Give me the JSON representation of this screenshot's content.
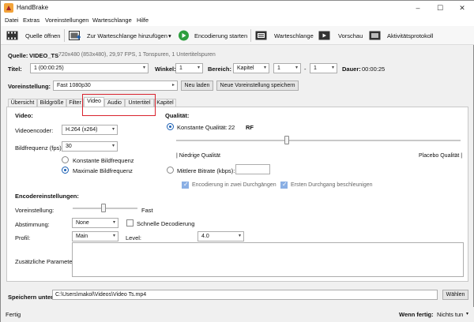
{
  "window": {
    "title": "HandBrake",
    "minimize": "–",
    "maximize": "☐",
    "close": "✕"
  },
  "menu": [
    "Datei",
    "Extras",
    "Voreinstellungen",
    "Warteschlange",
    "Hilfe"
  ],
  "toolbar": {
    "open_source": "Quelle öffnen",
    "add_queue": "Zur Warteschlange hinzufügen",
    "add_queue_arrow": "▾",
    "start": "Encodierung starten",
    "queue": "Warteschlange",
    "preview": "Vorschau",
    "activity": "Aktivitätsprotokoll"
  },
  "source": {
    "label": "Quelle:",
    "name": "VIDEO_TS",
    "info": "720x480 (853x480), 29,97 FPS, 1 Tonspuren, 1 Untertitelspuren"
  },
  "title_row": {
    "title_label": "Titel:",
    "title_value": "1 (00:00:25)",
    "angle_label": "Winkel:",
    "angle_value": "1",
    "range_label": "Bereich:",
    "range_type": "Kapitel",
    "range_from": "1",
    "range_sep": "-",
    "range_to": "1",
    "duration_label": "Dauer:",
    "duration_value": "00:00:25"
  },
  "preset": {
    "label": "Voreinstellung:",
    "value": "Fast 1080p30",
    "reload": "Neu laden",
    "save_new": "Neue Voreinstellung speichern"
  },
  "tabs": [
    "Übersicht",
    "Bildgröße",
    "Filter",
    "Video",
    "Audio",
    "Untertitel",
    "Kapitel"
  ],
  "active_tab": "Video",
  "video": {
    "section": "Video:",
    "encoder_label": "Videoencoder:",
    "encoder_value": "H.264 (x264)",
    "fps_label": "Bildfrequenz (fps):",
    "fps_value": "30",
    "constant_fps": "Konstante Bildfrequenz",
    "peak_fps": "Maximale Bildfrequenz",
    "peak_fps_selected": true
  },
  "quality": {
    "section": "Qualität:",
    "cq_label": "Konstante Qualität:",
    "cq_value": "22",
    "cq_unit": "RF",
    "low": "| Niedrige Qualität",
    "high": "Placebo Qualität |",
    "slider_level": 0.39,
    "avg_bitrate_label": "Mittlere Bitrate (kbps):",
    "two_pass": "Encodierung in zwei Durchgängen",
    "turbo": "Ersten Durchgang beschleunigen"
  },
  "encoder_settings": {
    "section": "Encodereinstellungen:",
    "preset_label": "Voreinstellung:",
    "preset_fast": "Fast",
    "preset_level": 0.47,
    "tune_label": "Abstimmung:",
    "tune_value": "None",
    "fast_decode": "Schnelle Decodierung",
    "profile_label": "Profil:",
    "profile_value": "Main",
    "level_label": "Level:",
    "level_value": "4.0",
    "extra_label": "Zusätzliche Parameter:"
  },
  "save": {
    "label": "Speichern unter:",
    "path": "C:\\Users\\makol\\Videos\\Video Ts.mp4",
    "browse": "Wählen"
  },
  "status": {
    "left": "Fertig",
    "when_done_label": "Wenn fertig:",
    "when_done_value": "Nichts tun"
  },
  "colors": {
    "accent": "#1a5fb4",
    "highlight": "#d9232e",
    "start_green": "#2e9e3e"
  }
}
